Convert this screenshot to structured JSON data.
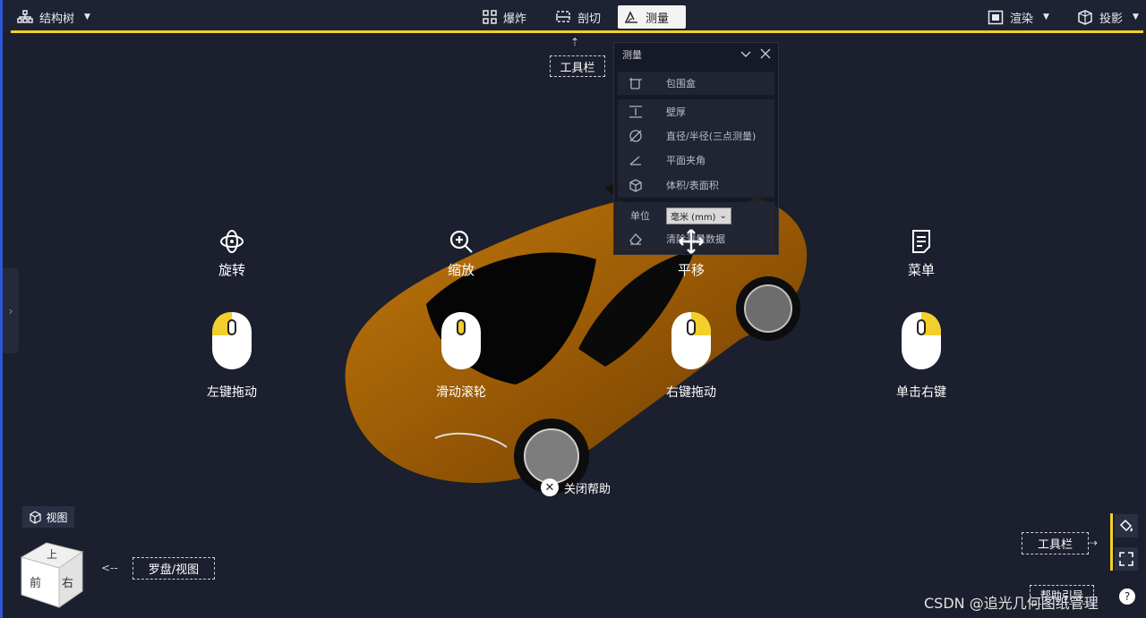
{
  "toolbar": {
    "structure_tree": "结构树",
    "explode": "爆炸",
    "section": "剖切",
    "measure": "测量",
    "render": "渲染",
    "projection": "投影"
  },
  "callouts": {
    "toolbar_top": "工具栏",
    "toolbar_right": "工具栏",
    "compass_view": "罗盘/视图",
    "help_guide": "帮助引导"
  },
  "measure_panel": {
    "title": "测量",
    "items": [
      {
        "label": "包围盒",
        "icon": "bounding-box-icon"
      },
      {
        "label": "壁厚",
        "icon": "wall-thickness-icon"
      },
      {
        "label": "直径/半径(三点测量)",
        "icon": "diameter-icon"
      },
      {
        "label": "平面夹角",
        "icon": "angle-icon"
      },
      {
        "label": "体积/表面积",
        "icon": "volume-icon"
      }
    ],
    "unit_label": "单位",
    "unit_value": "毫米 (mm)",
    "clear_label": "清除测量数据"
  },
  "help": {
    "actions": [
      {
        "label": "旋转",
        "mouse": "左键拖动",
        "icon": "rotate-icon",
        "button": "left"
      },
      {
        "label": "缩放",
        "mouse": "滑动滚轮",
        "icon": "zoom-icon",
        "button": "wheel"
      },
      {
        "label": "平移",
        "mouse": "右键拖动",
        "icon": "pan-icon",
        "button": "right"
      },
      {
        "label": "菜单",
        "mouse": "单击右键",
        "icon": "menu-icon",
        "button": "right"
      }
    ],
    "close_label": "关闭帮助"
  },
  "view": {
    "button_label": "视图",
    "cube_faces": {
      "top": "上",
      "front": "前",
      "right": "右"
    }
  },
  "watermark": "CSDN @追光几何图纸管理",
  "colors": {
    "accent": "#f2cf2a",
    "background": "#1b1f2e",
    "edge": "#2f55d4"
  }
}
